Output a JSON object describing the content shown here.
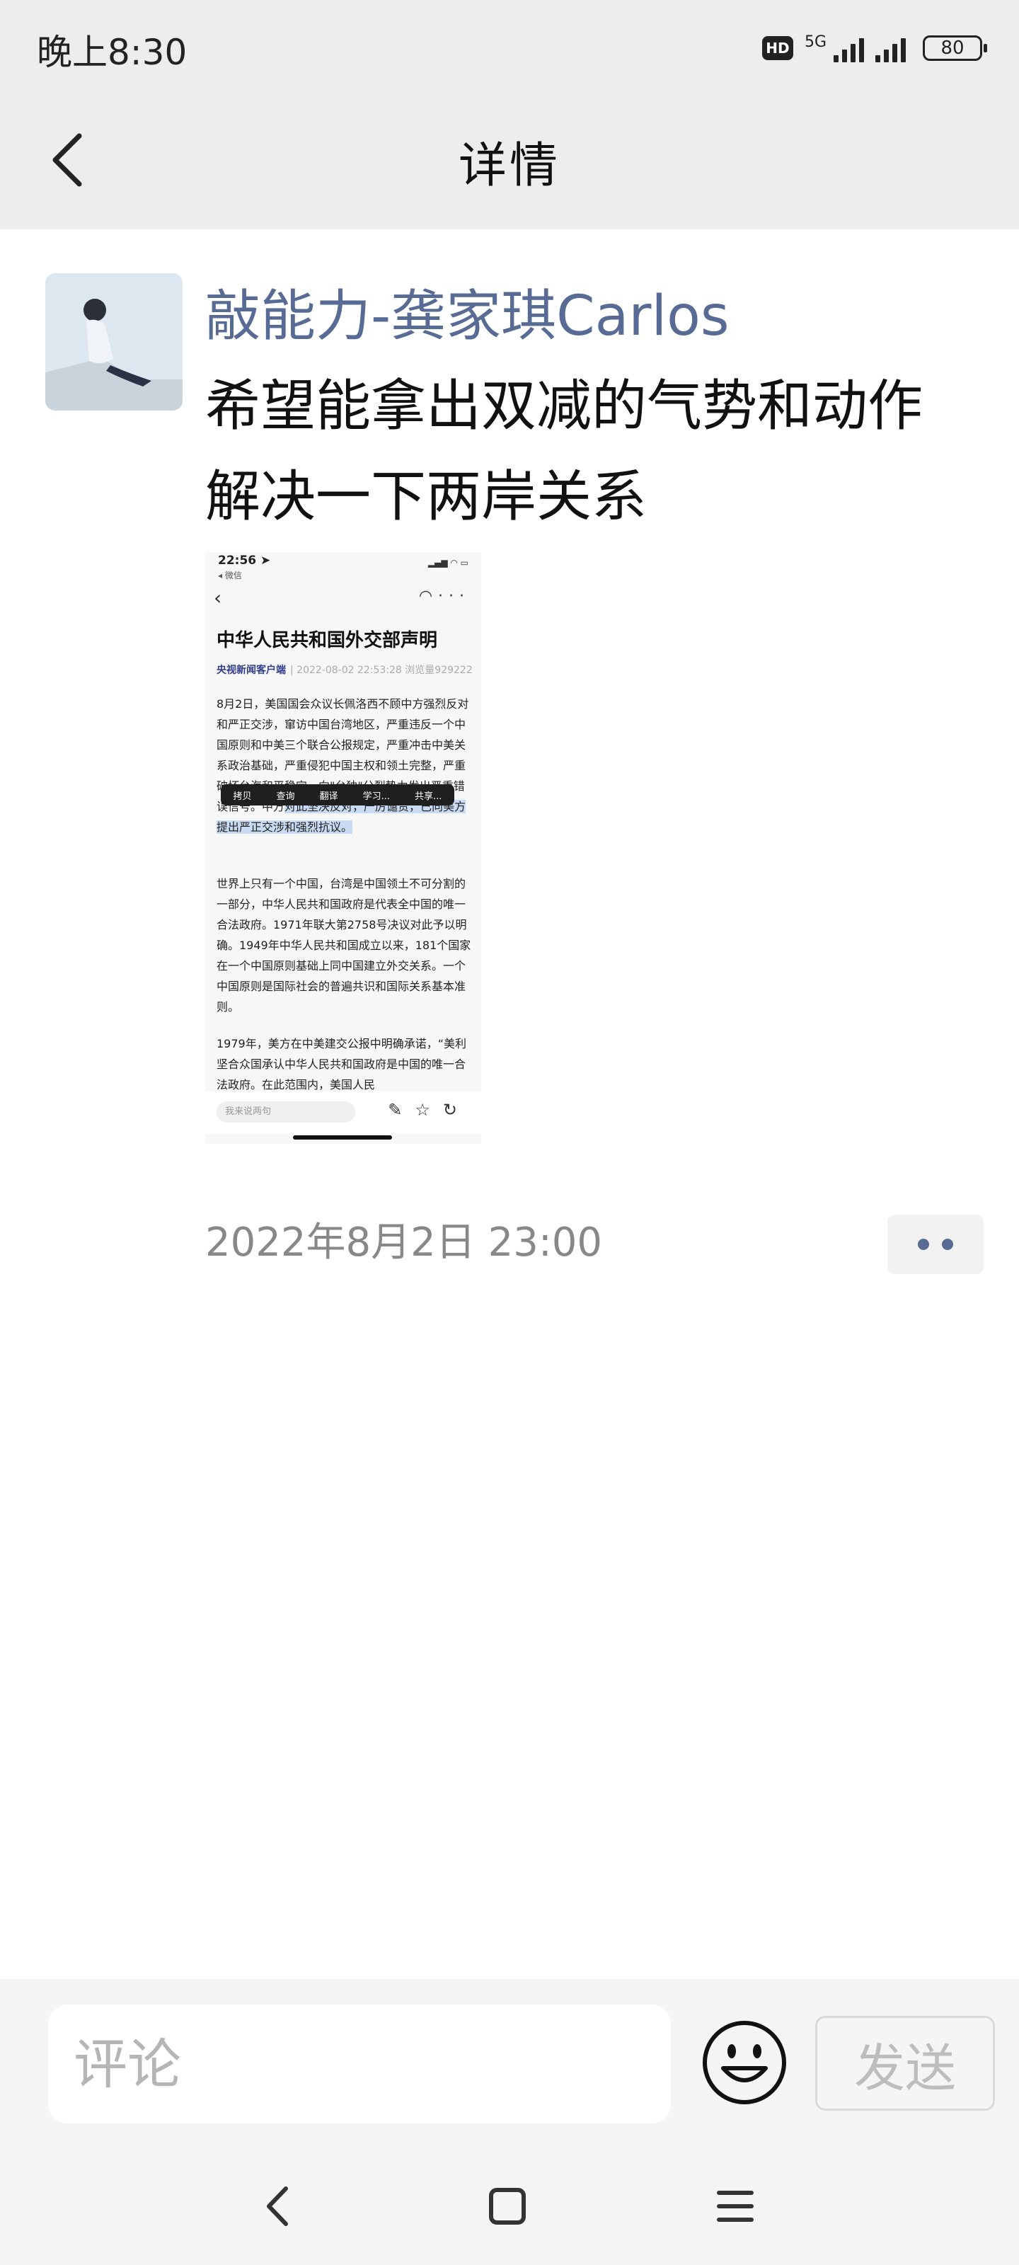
{
  "status_bar": {
    "time": "晚上8:30",
    "hd": "HD",
    "network": "5G",
    "battery": "80"
  },
  "navbar": {
    "title": "详情",
    "back_icon": "chevron-left-icon"
  },
  "post": {
    "author": "敲能力-龚家琪Carlos",
    "text": "希望能拿出双减的气势和动作解决一下两岸关系",
    "time": "2022年8月2日 23:00"
  },
  "screenshot": {
    "status_time": "22:56 ➤",
    "status_sub": "◂ 微信",
    "title": "中华人民共和国外交部声明",
    "source": "央视新闻客户端",
    "meta": "| 2022-08-02 22:53:28  浏览量929222",
    "para1_a": "8月2日，美国国会众议长佩洛西不顾中方强烈反对和严正交涉，窜访中国台湾地区，严重违反一个中国原则和中美三个联合公报规定，严重冲击中美关系政治基础，严重侵犯中国主权和领土完整，严重破坏台海和平稳定，向\"台独\"分裂势力发出严重错误信号。中方",
    "para1_b": "对此坚决反对，严厉谴责，已向美方提出严正交涉和强烈抗议。",
    "para2": "世界上只有一个中国，台湾是中国领土不可分割的一部分，中华人民共和国政府是代表全中国的唯一合法政府。1971年联大第2758号决议对此予以明确。1949年中华人民共和国成立以来，181个国家在一个中国原则基础上同中国建立外交关系。一个中国原则是国际社会的普遍共识和国际关系基本准则。",
    "para3": "1979年，美方在中美建交公报中明确承诺，“美利坚合众国承认中华人民共和国政府是中国的唯一合法政府。在此范围内，美国人民",
    "menu": [
      "拷贝",
      "查询",
      "翻译",
      "学习...",
      "共享..."
    ],
    "comment_placeholder": "我来说两句"
  },
  "comment_bar": {
    "placeholder": "评论",
    "send_label": "发送",
    "emoji_icon": "smiley-face-icon"
  },
  "system_nav": {
    "back_icon": "triangle-back-icon",
    "home_icon": "square-home-icon",
    "menu_icon": "hamburger-menu-icon"
  }
}
